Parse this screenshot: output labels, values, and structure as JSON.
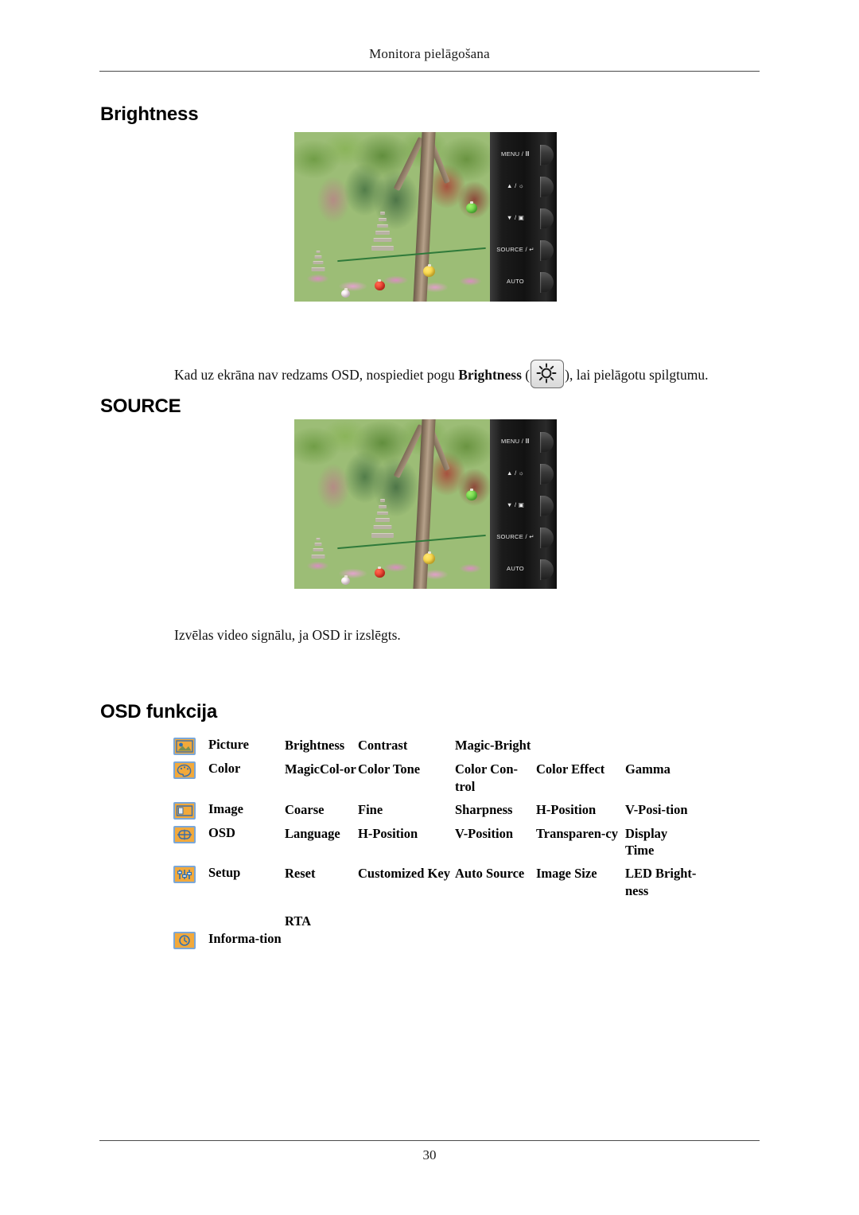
{
  "header": {
    "running_title": "Monitora pielāgošana"
  },
  "sections": {
    "brightness": {
      "heading": "Brightness",
      "text_before_bold": "Kad uz ekrāna nav redzams OSD, nospiediet pogu ",
      "bold_term": "Brightness",
      "text_after_bold": "), lai pielāgotu spilgtumu.",
      "open_paren": " (",
      "key_icon": "brightness-sun-icon"
    },
    "source": {
      "heading": "SOURCE",
      "text": "Izvēlas video signālu, ja OSD ir izslēgts."
    },
    "osd": {
      "heading": "OSD funkcija"
    }
  },
  "monitor": {
    "buttons": [
      {
        "label": "MENU / Ⅲ",
        "name": "menu-button"
      },
      {
        "label": "▲ / ☼",
        "name": "up-brightness-button"
      },
      {
        "label": "▼ / ▣",
        "name": "down-magicbright-button"
      },
      {
        "label": "SOURCE / ↵",
        "name": "source-enter-button"
      },
      {
        "label": "AUTO",
        "name": "auto-button"
      }
    ],
    "photo_description": "Korean garden with stone pagodas, trees and paper lanterns"
  },
  "osd_table": {
    "rows": [
      {
        "icon": "picture-icon",
        "menu": "Picture",
        "items": [
          "Brightness",
          "Contrast",
          "Magic-Bright",
          "",
          ""
        ]
      },
      {
        "icon": "color-palette-icon",
        "menu": "Color",
        "items": [
          "MagicCol-or",
          "Color Tone",
          "Color  Con-trol",
          "Color Effect",
          "Gamma"
        ]
      },
      {
        "icon": "image-icon",
        "menu": "Image",
        "items": [
          "Coarse",
          "Fine",
          "Sharpness",
          "H-Position",
          "V-Posi-tion"
        ]
      },
      {
        "icon": "osd-icon",
        "menu": "OSD",
        "items": [
          "Language",
          "H-Position",
          "V-Position",
          "Transparen-cy",
          "Display Time"
        ]
      },
      {
        "icon": "setup-sliders-icon",
        "menu": "Setup",
        "items": [
          "Reset",
          "Customized Key",
          "Auto Source",
          "Image Size",
          "LED Bright-ness"
        ]
      }
    ],
    "rta_label": "RTA",
    "information": {
      "icon": "information-clock-icon",
      "menu": "Informa-tion"
    }
  },
  "footer": {
    "page_number": "30"
  },
  "colors": {
    "icon_fill": "#f2a93b",
    "icon_border": "#7ba7d7",
    "rule": "#4a4a4a"
  }
}
